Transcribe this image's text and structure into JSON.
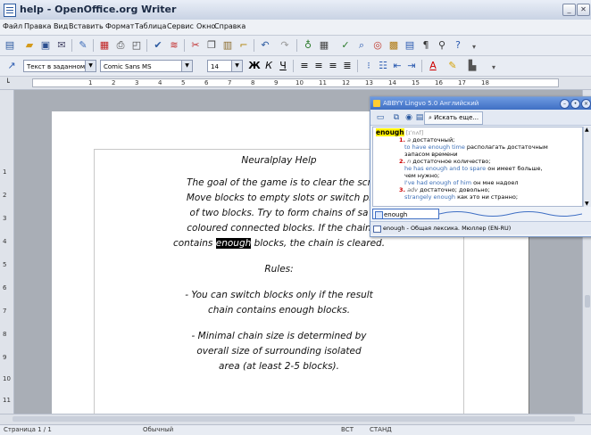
{
  "window": {
    "title": "help - OpenOffice.org Writer"
  },
  "menu": [
    "Файл",
    "Правка",
    "Вид",
    "Вставить",
    "Формат",
    "Таблица",
    "Сервис",
    "Окно",
    "Справка"
  ],
  "format_bar": {
    "style": "Текст в заданном фор",
    "font": "Comic Sans MS",
    "size": "14"
  },
  "ruler": {
    "h_ticks": [
      "1",
      "2",
      "3",
      "4",
      "5",
      "6",
      "7",
      "8",
      "9",
      "10",
      "11",
      "12",
      "13",
      "14",
      "15",
      "16",
      "17",
      "18"
    ],
    "v_ticks": [
      "1",
      "2",
      "3",
      "4",
      "5",
      "6",
      "7",
      "8",
      "9",
      "10",
      "11"
    ]
  },
  "document": {
    "heading": "Neuralplay Help",
    "para1_lines": [
      "The goal of the game is to clear the scr",
      "Move blocks to empty slots or switch pl",
      "of two blocks. Try to form chains of sa",
      "coloured connected blocks. If the chain"
    ],
    "para1_last_before": "contains ",
    "para1_highlight": "enough",
    "para1_last_after": " blocks, the chain is cleared.",
    "rules_heading": "Rules:",
    "rule1_lines": [
      "- You can switch blocks only if the result",
      "chain contains enough blocks."
    ],
    "rule2_lines": [
      "- Minimal chain size is determined by",
      "overall size of surrounding isolated",
      "area (at least 2-5 blocks)."
    ]
  },
  "dictionary_popup": {
    "title": "ABBYY Lingvo 5.0 Английский",
    "search_label": "Искать еще...",
    "headword": "enough",
    "transcription": "[ɪˈnʌf]",
    "senses": [
      {
        "num": "1.",
        "pos": "a",
        "translation": "достаточный;",
        "examples": [
          {
            "en": "to have enough time",
            "ru": "располагать достаточным"
          },
          {
            "en": "",
            "ru": "запасом времени"
          }
        ]
      },
      {
        "num": "2.",
        "pos": "n",
        "translation": "достаточное количество;",
        "examples": [
          {
            "en": "he has enough and to spare",
            "ru": "он имеет больше,"
          },
          {
            "en": "",
            "ru": "чем нужно;"
          },
          {
            "en": "I've had enough of him",
            "ru": "он мне надоел"
          }
        ]
      },
      {
        "num": "3.",
        "pos": "adv",
        "translation": "достаточно; довольно;",
        "examples": [
          {
            "en": "strangely enough",
            "ru": "как это ни странно;"
          }
        ]
      }
    ],
    "word_tab": "enough",
    "source": "enough - Общая лексика. Мюллер (EN-RU)"
  },
  "statusbar": {
    "page": "Страница 1 / 1",
    "style": "Обычный",
    "mode1": "ВСТ",
    "mode2": "СТАНД"
  },
  "colors": {
    "accent": "#3f6fc4",
    "highlight": "#fff200",
    "example": "#3c6fb7",
    "sense_num": "#cc0000"
  }
}
